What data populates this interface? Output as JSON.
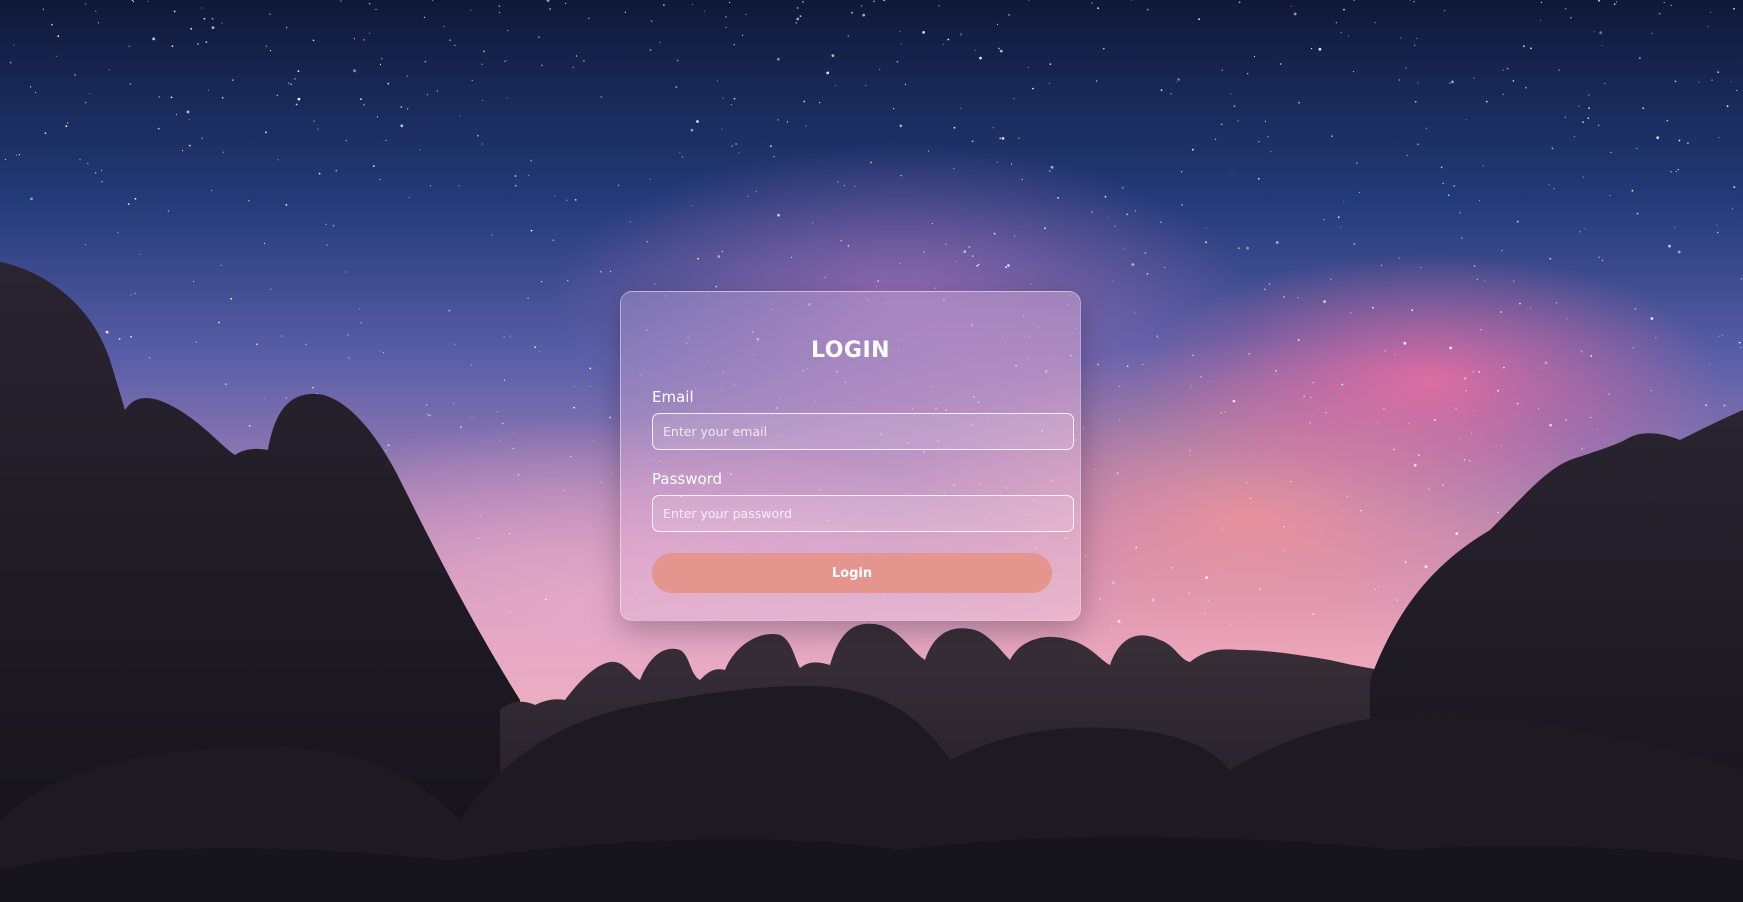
{
  "login_form": {
    "title": "LOGIN",
    "email": {
      "label": "Email",
      "value": "",
      "placeholder": "Enter your email"
    },
    "password": {
      "label": "Password",
      "value": "",
      "placeholder": "Enter your password"
    },
    "submit_label": "Login"
  },
  "colors": {
    "button": "#e4958e",
    "text": "#ffffff",
    "sky_top": "#0f1838",
    "sky_glow_pink": "#f06ea0"
  }
}
